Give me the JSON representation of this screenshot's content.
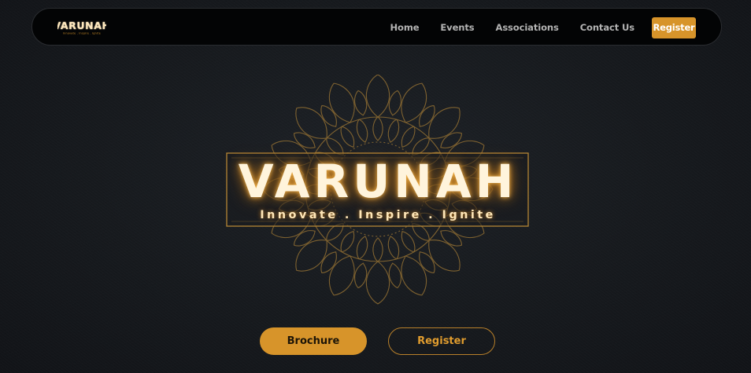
{
  "nav": {
    "logo_text": "VARUNAH",
    "logo_tagline": "Innovate . Inspire . Ignite",
    "links": [
      "Home",
      "Events",
      "Associations",
      "Contact Us"
    ],
    "register_label": "Register"
  },
  "hero": {
    "title": "VARUNAH",
    "tagline": "Innovate . Inspire . Ignite"
  },
  "actions": {
    "brochure_label": "Brochure",
    "register_label": "Register"
  },
  "colors": {
    "accent": "#d7942a",
    "background": "#16191d",
    "navbar": "#030405",
    "glow": "#f0961e"
  },
  "icons": {
    "mandala": "mandala-ornament"
  }
}
